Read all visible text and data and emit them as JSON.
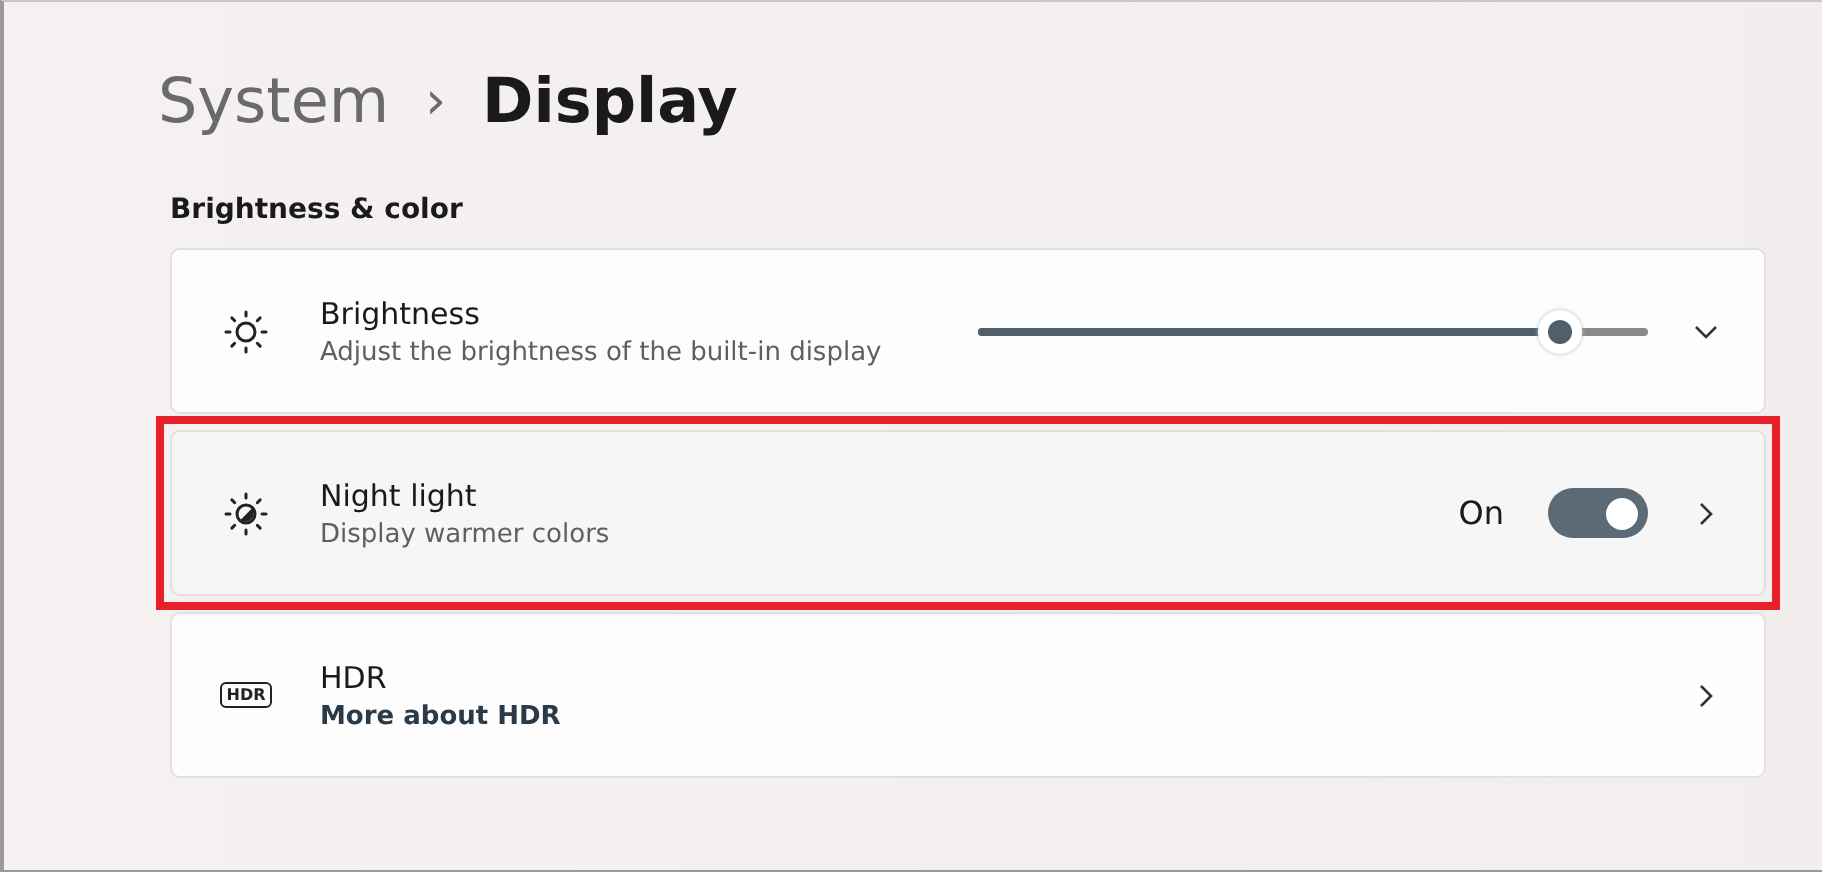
{
  "breadcrumb": {
    "parent": "System",
    "separator": "›",
    "current": "Display"
  },
  "section_title": "Brightness & color",
  "settings": [
    {
      "kind": "slider",
      "title": "Brightness",
      "subtitle": "Adjust the brightness of the built-in display",
      "level": 0.87,
      "highlighted": false,
      "expanded": false
    },
    {
      "kind": "toggle",
      "title": "Night light",
      "subtitle": "Display warmer colors",
      "state_label": "On",
      "on": true,
      "highlighted": true
    },
    {
      "kind": "link",
      "icon_text": "HDR",
      "title": "HDR",
      "link": "More about HDR",
      "highlighted": false
    }
  ]
}
